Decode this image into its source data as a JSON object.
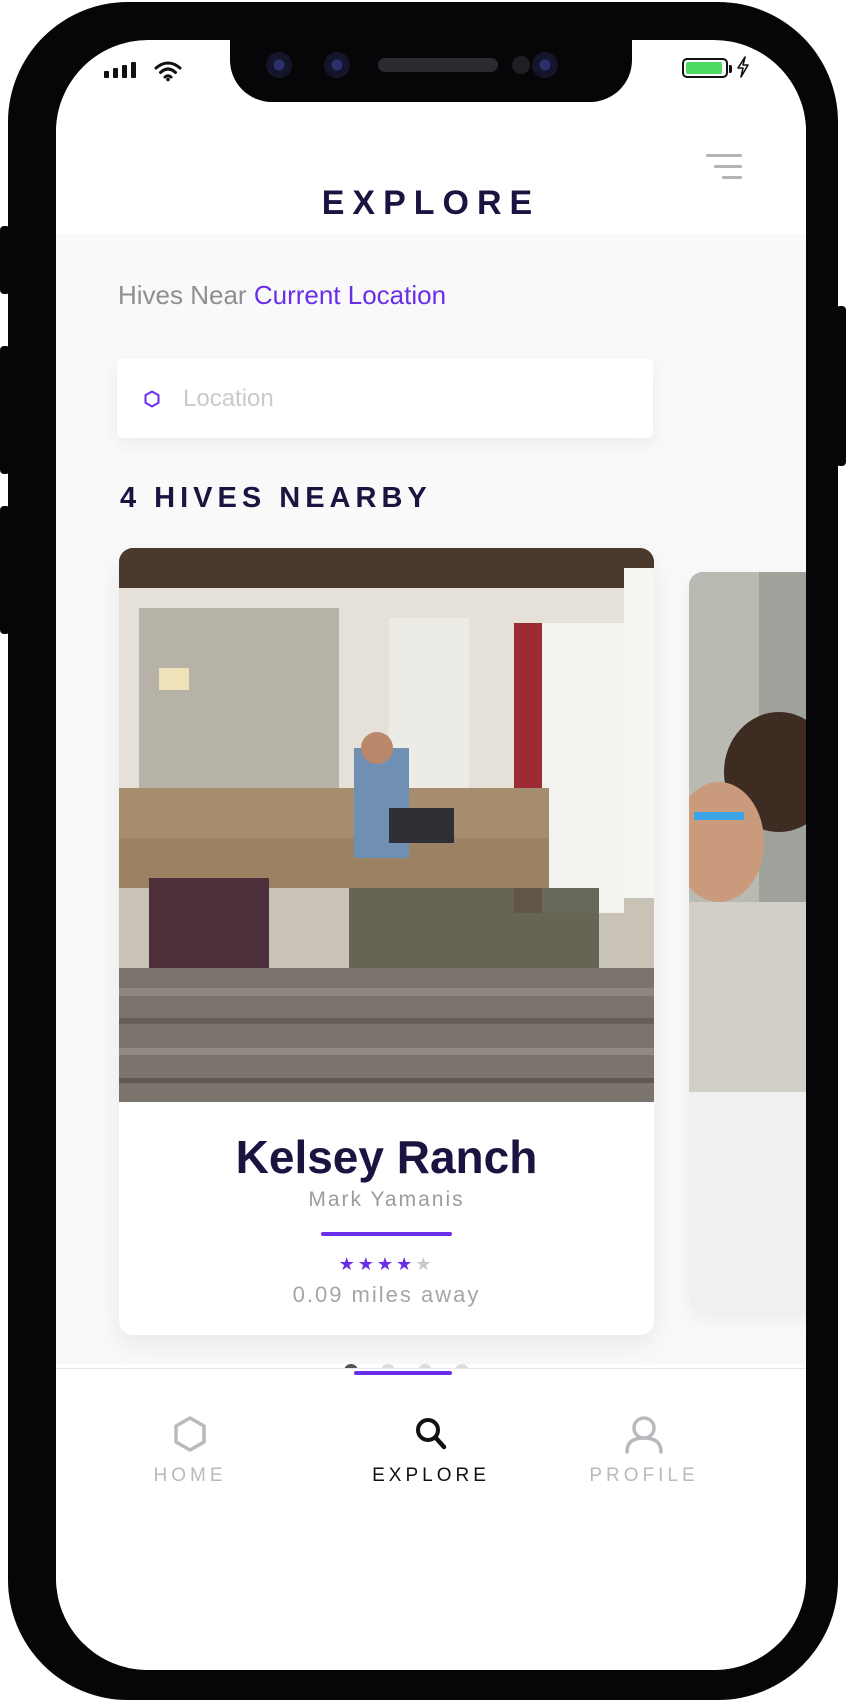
{
  "header": {
    "title": "EXPLORE"
  },
  "location_prompt": {
    "prefix": "Hives Near",
    "link": "Current Location"
  },
  "search": {
    "placeholder": "Location"
  },
  "results": {
    "title": "4 HIVES NEARBY"
  },
  "cards": [
    {
      "title": "Kelsey Ranch",
      "host": "Mark Yamanis",
      "rating": 4,
      "rating_max": 5,
      "distance": "0.09 miles away"
    }
  ],
  "pagination": {
    "count": 4,
    "active": 0
  },
  "tabs": [
    {
      "label": "HOME",
      "icon": "hexagon-icon",
      "active": false
    },
    {
      "label": "EXPLORE",
      "icon": "search-icon",
      "active": true
    },
    {
      "label": "PROFILE",
      "icon": "user-icon",
      "active": false
    }
  ],
  "colors": {
    "accent": "#6a2ee8",
    "heading": "#1c1340",
    "battery": "#4cd964"
  }
}
